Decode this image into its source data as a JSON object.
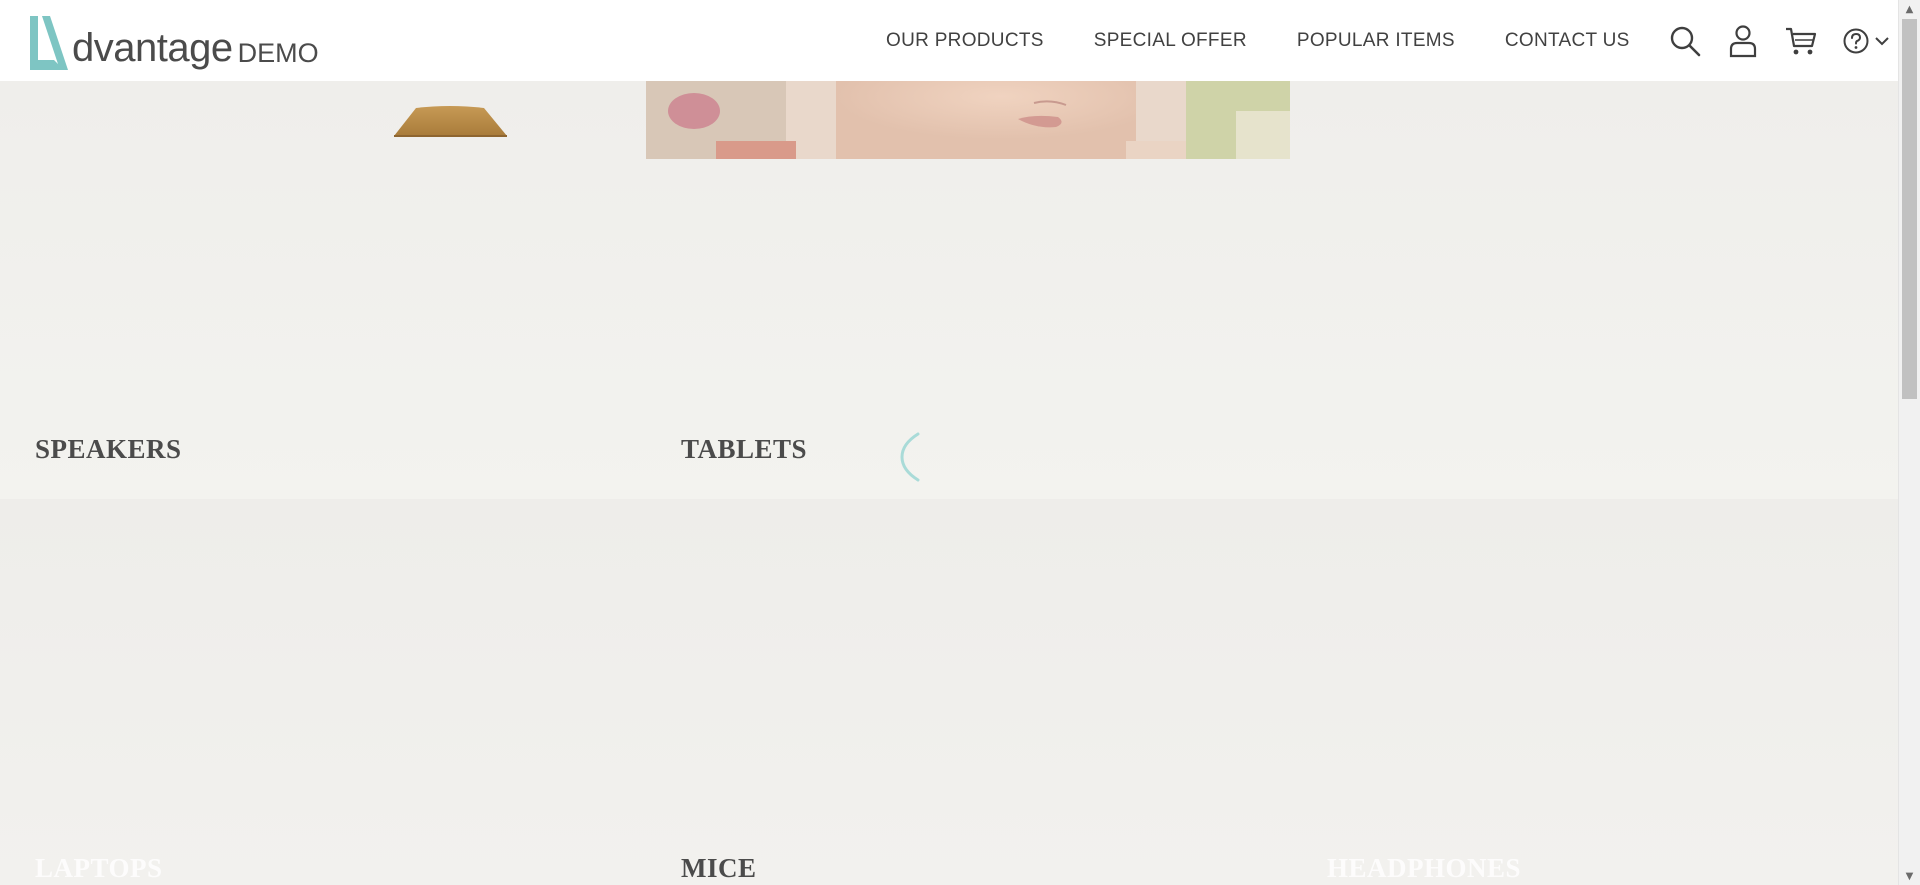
{
  "logo": {
    "word": "dvantage",
    "suffix": "DEMO",
    "mark_color": "#7ec5c3"
  },
  "nav": {
    "items": [
      {
        "label": "OUR PRODUCTS"
      },
      {
        "label": "SPECIAL OFFER"
      },
      {
        "label": "POPULAR ITEMS"
      },
      {
        "label": "CONTACT US"
      }
    ],
    "icons": [
      "search-icon",
      "user-icon",
      "cart-icon",
      "help-icon",
      "chevron-down-icon"
    ]
  },
  "categories": {
    "speakers": "SPEAKERS",
    "tablets": "TABLETS",
    "laptops": "LAPTOPS",
    "mice": "MICE",
    "headphones": "HEADPHONES"
  },
  "colors": {
    "accent": "#7ec5c3",
    "text": "#4b4b4b",
    "background": "#f1f0ed"
  }
}
